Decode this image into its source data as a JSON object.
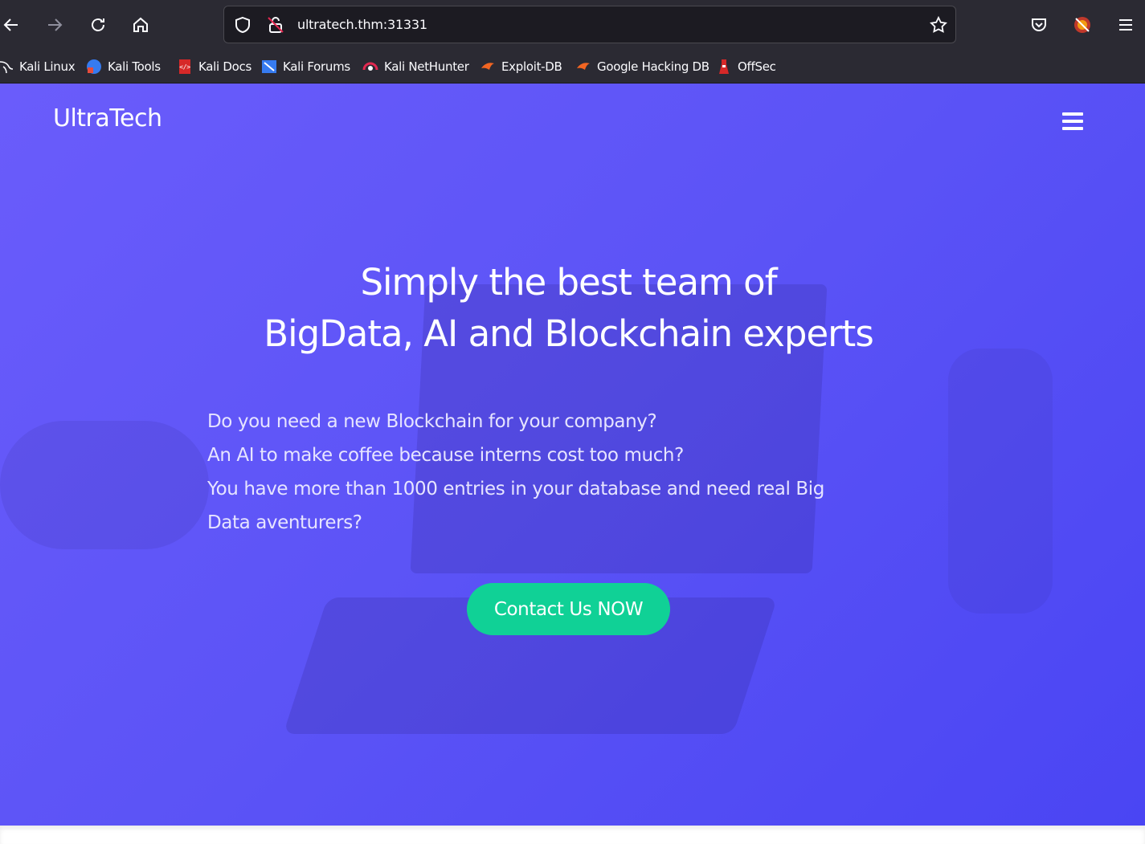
{
  "browser": {
    "url": "ultratech.thm:31331",
    "bookmarks": [
      {
        "label": "Kali Linux",
        "icon": "kali-dragon-icon"
      },
      {
        "label": "Kali Tools",
        "icon": "kali-tools-icon"
      },
      {
        "label": "Kali Docs",
        "icon": "kali-docs-icon"
      },
      {
        "label": "Kali Forums",
        "icon": "kali-forums-icon"
      },
      {
        "label": "Kali NetHunter",
        "icon": "nethunter-icon"
      },
      {
        "label": "Exploit-DB",
        "icon": "exploit-db-icon"
      },
      {
        "label": "Google Hacking DB",
        "icon": "ghdb-icon"
      },
      {
        "label": "OffSec",
        "icon": "offsec-icon"
      }
    ]
  },
  "site": {
    "brand": "UltraTech",
    "headline_line1": "Simply the best team of",
    "headline_line2": "BigData, AI and Blockchain experts",
    "questions": [
      "Do you need a new Blockchain for your company?",
      "An AI to make coffee because interns cost too much?",
      "You have more than 1000 entries in your database and need real Big Data aventurers?"
    ],
    "cta_label": "Contact Us NOW"
  },
  "colors": {
    "hero_gradient_start": "#6a5cfb",
    "hero_gradient_end": "#4a45f3",
    "cta": "#10d196",
    "chrome": "#2b2a33"
  }
}
